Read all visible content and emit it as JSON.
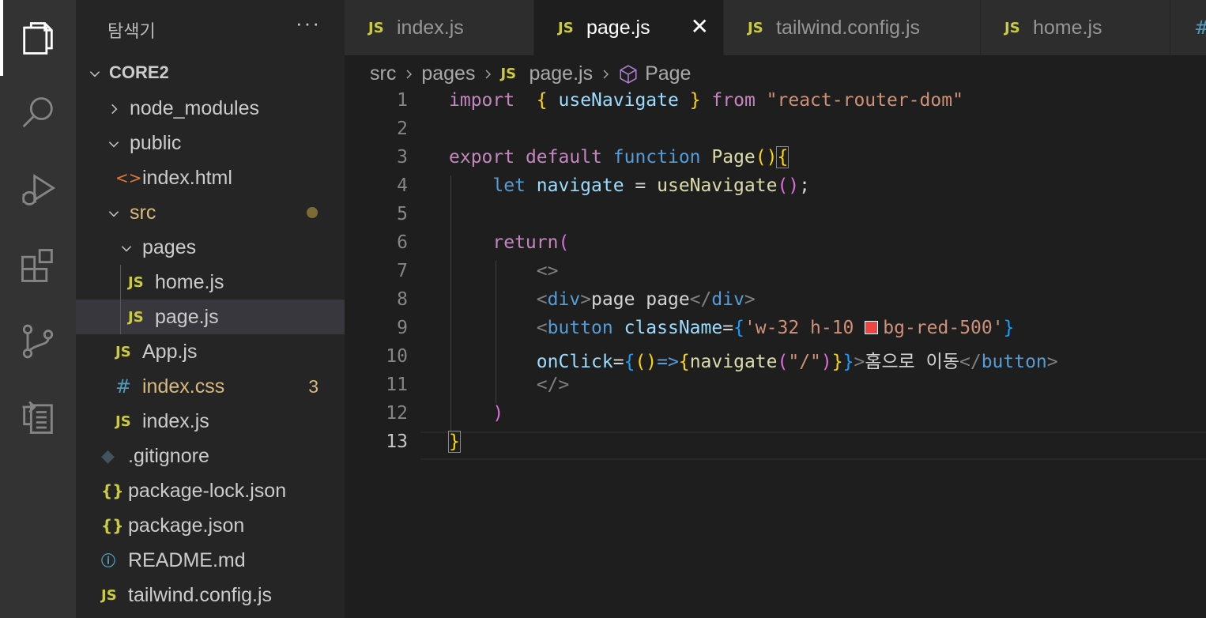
{
  "activity_bar": {
    "items": [
      {
        "name": "explorer-icon"
      },
      {
        "name": "search-icon"
      },
      {
        "name": "run-debug-icon"
      },
      {
        "name": "extensions-icon"
      },
      {
        "name": "source-control-icon"
      },
      {
        "name": "remote-explorer-icon"
      }
    ]
  },
  "sidebar": {
    "title": "탐색기",
    "more": "···",
    "project": "CORE2",
    "items": [
      {
        "label": "node_modules",
        "icon": "chevron-right-icon"
      },
      {
        "label": "public",
        "icon": "chevron-down-icon"
      },
      {
        "label": "index.html",
        "icon": "html-file-icon",
        "icon_text": "<>"
      },
      {
        "label": "src",
        "icon": "chevron-down-icon"
      },
      {
        "label": "pages",
        "icon": "chevron-down-icon"
      },
      {
        "label": "home.js",
        "icon": "js-file-icon",
        "icon_text": "JS"
      },
      {
        "label": "page.js",
        "icon": "js-file-icon",
        "icon_text": "JS"
      },
      {
        "label": "App.js",
        "icon": "js-file-icon",
        "icon_text": "JS"
      },
      {
        "label": "index.css",
        "icon": "css-file-icon",
        "icon_text": "#",
        "badge": "3"
      },
      {
        "label": "index.js",
        "icon": "js-file-icon",
        "icon_text": "JS"
      },
      {
        "label": ".gitignore",
        "icon": "git-file-icon",
        "icon_text": "◆"
      },
      {
        "label": "package-lock.json",
        "icon": "json-file-icon",
        "icon_text": "{}"
      },
      {
        "label": "package.json",
        "icon": "json-file-icon",
        "icon_text": "{}"
      },
      {
        "label": "README.md",
        "icon": "info-file-icon",
        "icon_text": "ⓘ"
      },
      {
        "label": "tailwind.config.js",
        "icon": "js-file-icon",
        "icon_text": "JS"
      }
    ]
  },
  "tabs": [
    {
      "label": "index.js",
      "icon_text": "JS",
      "active": false
    },
    {
      "label": "page.js",
      "icon_text": "JS",
      "active": true,
      "close": "✕"
    },
    {
      "label": "tailwind.config.js",
      "icon_text": "JS",
      "active": false
    },
    {
      "label": "home.js",
      "icon_text": "JS",
      "active": false
    },
    {
      "label": "",
      "icon_text": "#",
      "active": false
    }
  ],
  "breadcrumb": {
    "parts": [
      "src",
      "pages",
      "page.js",
      "Page"
    ],
    "file_icon_text": "JS",
    "symbol_icon": "symbol-class-icon"
  },
  "editor": {
    "active_line": 13,
    "line_numbers": [
      "1",
      "2",
      "3",
      "4",
      "5",
      "6",
      "7",
      "8",
      "9",
      "10",
      "11",
      "12",
      "13"
    ],
    "lines": [
      [
        [
          "kw",
          "import"
        ],
        [
          "",
          "  "
        ],
        [
          "p1",
          "{"
        ],
        [
          "",
          " "
        ],
        [
          "var",
          "useNavigate"
        ],
        [
          "",
          " "
        ],
        [
          "p1",
          "}"
        ],
        [
          "",
          " "
        ],
        [
          "kw",
          "from"
        ],
        [
          "",
          " "
        ],
        [
          "str",
          "\"react-router-dom\""
        ]
      ],
      [],
      [
        [
          "kw",
          "export"
        ],
        [
          "",
          " "
        ],
        [
          "kw",
          "default"
        ],
        [
          "",
          " "
        ],
        [
          "kwb",
          "function"
        ],
        [
          "",
          " "
        ],
        [
          "fn",
          "Page"
        ],
        [
          "p1",
          "()"
        ],
        [
          "p1box",
          "{"
        ]
      ],
      [
        [
          "",
          "    "
        ],
        [
          "kwb",
          "let"
        ],
        [
          "",
          " "
        ],
        [
          "var",
          "navigate"
        ],
        [
          "",
          " = "
        ],
        [
          "fn",
          "useNavigate"
        ],
        [
          "p2",
          "()"
        ],
        [
          "",
          ";"
        ]
      ],
      [],
      [
        [
          "",
          "    "
        ],
        [
          "kw",
          "return"
        ],
        [
          "p2",
          "("
        ]
      ],
      [
        [
          "",
          "        "
        ],
        [
          "tagp",
          "<>"
        ]
      ],
      [
        [
          "",
          "        "
        ],
        [
          "tagp",
          "<"
        ],
        [
          "tag",
          "div"
        ],
        [
          "tagp",
          ">"
        ],
        [
          "",
          "page page"
        ],
        [
          "tagp",
          "</"
        ],
        [
          "tag",
          "div"
        ],
        [
          "tagp",
          ">"
        ]
      ],
      [
        [
          "",
          "        "
        ],
        [
          "tagp",
          "<"
        ],
        [
          "tag",
          "button"
        ],
        [
          "",
          " "
        ],
        [
          "attr",
          "className"
        ],
        [
          "",
          "="
        ],
        [
          "p3",
          "{"
        ],
        [
          "str",
          "'w-32 h-10 "
        ],
        [
          "swatch",
          ""
        ],
        [
          "str",
          "bg-red-500'"
        ],
        [
          "p3",
          "}"
        ]
      ],
      [
        [
          "",
          "        "
        ],
        [
          "attr",
          "onClick"
        ],
        [
          "",
          "="
        ],
        [
          "p3",
          "{"
        ],
        [
          "p1",
          "()"
        ],
        [
          "kwb",
          "=>"
        ],
        [
          "p1",
          "{"
        ],
        [
          "fn",
          "navigate"
        ],
        [
          "p2",
          "("
        ],
        [
          "str",
          "\"/\""
        ],
        [
          "p2",
          ")"
        ],
        [
          "p1",
          "}"
        ],
        [
          "p3",
          "}"
        ],
        [
          "tagp",
          ">"
        ],
        [
          "",
          "홈으로 이동"
        ],
        [
          "tagp",
          "</"
        ],
        [
          "tag",
          "button"
        ],
        [
          "tagp",
          ">"
        ]
      ],
      [
        [
          "",
          "        "
        ],
        [
          "tagp",
          "</>"
        ]
      ],
      [
        [
          "",
          "    "
        ],
        [
          "p2",
          ")"
        ]
      ],
      [
        [
          "p1box",
          "}"
        ]
      ]
    ]
  },
  "colors": {
    "activity_bar": "#333333",
    "sidebar": "#252526",
    "editor": "#1e1e1e",
    "js_icon": "#cbcb41",
    "modified": "#d7ba7d",
    "swatch_red_500": "#ef4444"
  }
}
